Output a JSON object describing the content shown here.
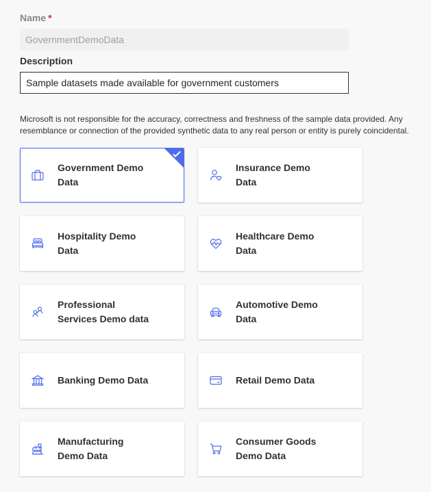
{
  "form": {
    "name_label": "Name",
    "name_required": "*",
    "name_value": "GovernmentDemoData",
    "description_label": "Description",
    "description_value": "Sample datasets made available for government customers"
  },
  "disclaimer": "Microsoft is not responsible for the accuracy, correctness and freshness of the sample data provided. Any resemblance or connection of the provided synthetic data to any real person or entity is purely coincidental.",
  "colors": {
    "accent": "#4f6bed",
    "icon": "#4f6bed"
  },
  "cards": [
    {
      "title": "Government Demo Data",
      "icon": "briefcase-icon",
      "selected": true
    },
    {
      "title": "Insurance Demo Data",
      "icon": "person-heart-icon",
      "selected": false
    },
    {
      "title": "Hospitality Demo Data",
      "icon": "bed-icon",
      "selected": false
    },
    {
      "title": "Healthcare Demo Data",
      "icon": "heart-pulse-icon",
      "selected": false
    },
    {
      "title": "Professional Services Demo data",
      "icon": "people-icon",
      "selected": false
    },
    {
      "title": "Automotive Demo Data",
      "icon": "car-icon",
      "selected": false
    },
    {
      "title": "Banking Demo Data",
      "icon": "bank-icon",
      "selected": false
    },
    {
      "title": "Retail Demo Data",
      "icon": "credit-card-icon",
      "selected": false
    },
    {
      "title": "Manufacturing Demo Data",
      "icon": "factory-icon",
      "selected": false
    },
    {
      "title": "Consumer Goods Demo Data",
      "icon": "cart-icon",
      "selected": false
    }
  ]
}
